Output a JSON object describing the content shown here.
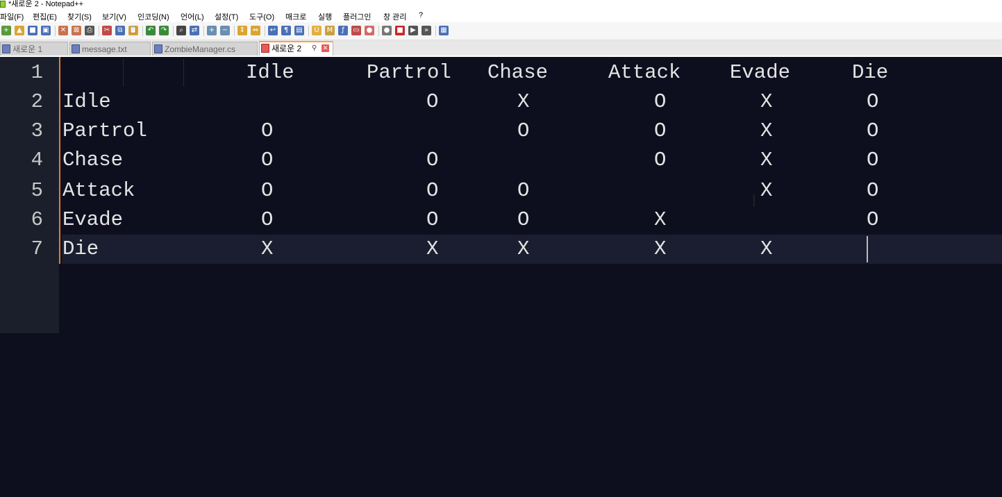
{
  "window": {
    "title": "*새로운 2 - Notepad++"
  },
  "menu": [
    "파일(F)",
    "편집(E)",
    "찾기(S)",
    "보기(V)",
    "인코딩(N)",
    "언어(L)",
    "설정(T)",
    "도구(O)",
    "매크로",
    "실행",
    "플러그인",
    "창 관리",
    "?"
  ],
  "tabs": [
    {
      "label": "새로운 1",
      "active": false
    },
    {
      "label": "message.txt",
      "active": false
    },
    {
      "label": "ZombieManager.cs",
      "active": false
    },
    {
      "label": "새로운 2",
      "active": true
    }
  ],
  "tab_pin_glyph": "⚲",
  "tab_close_glyph": "✕",
  "toolbar_icons": [
    "new-file-icon",
    "open-file-icon",
    "save-icon",
    "save-all-icon",
    "close-icon",
    "close-all-icon",
    "print-icon",
    "cut-icon",
    "copy-icon",
    "paste-icon",
    "undo-icon",
    "redo-icon",
    "find-icon",
    "replace-icon",
    "zoom-in-icon",
    "zoom-out-icon",
    "sync-vertical-icon",
    "sync-horizontal-icon",
    "word-wrap-icon",
    "show-all-chars-icon",
    "indent-guide-icon",
    "user-language-icon",
    "doc-map-icon",
    "function-list-icon",
    "folder-workspace-icon",
    "monitoring-icon",
    "record-macro-icon",
    "stop-record-icon",
    "playback-icon",
    "run-macro-multiple-icon",
    "save-macro-icon"
  ],
  "editor": {
    "line_numbers": [
      "1",
      "2",
      "3",
      "4",
      "5",
      "6",
      "7"
    ],
    "header_row": [
      "Idle",
      "Partrol",
      "Chase",
      "Attack",
      "Evade",
      "Die"
    ],
    "rows": [
      {
        "state": "Idle",
        "cells": [
          "",
          "O",
          "X",
          "O",
          "X",
          "O"
        ]
      },
      {
        "state": "Partrol",
        "cells": [
          "O",
          "",
          "O",
          "O",
          "X",
          "O"
        ]
      },
      {
        "state": "Chase",
        "cells": [
          "O",
          "O",
          "",
          "O",
          "X",
          "O"
        ]
      },
      {
        "state": "Attack",
        "cells": [
          "O",
          "O",
          "O",
          "",
          "X",
          "O"
        ]
      },
      {
        "state": "Evade",
        "cells": [
          "O",
          "O",
          "O",
          "X",
          "",
          "O"
        ]
      },
      {
        "state": "Die",
        "cells": [
          "X",
          "X",
          "X",
          "X",
          "X",
          ""
        ]
      }
    ]
  }
}
